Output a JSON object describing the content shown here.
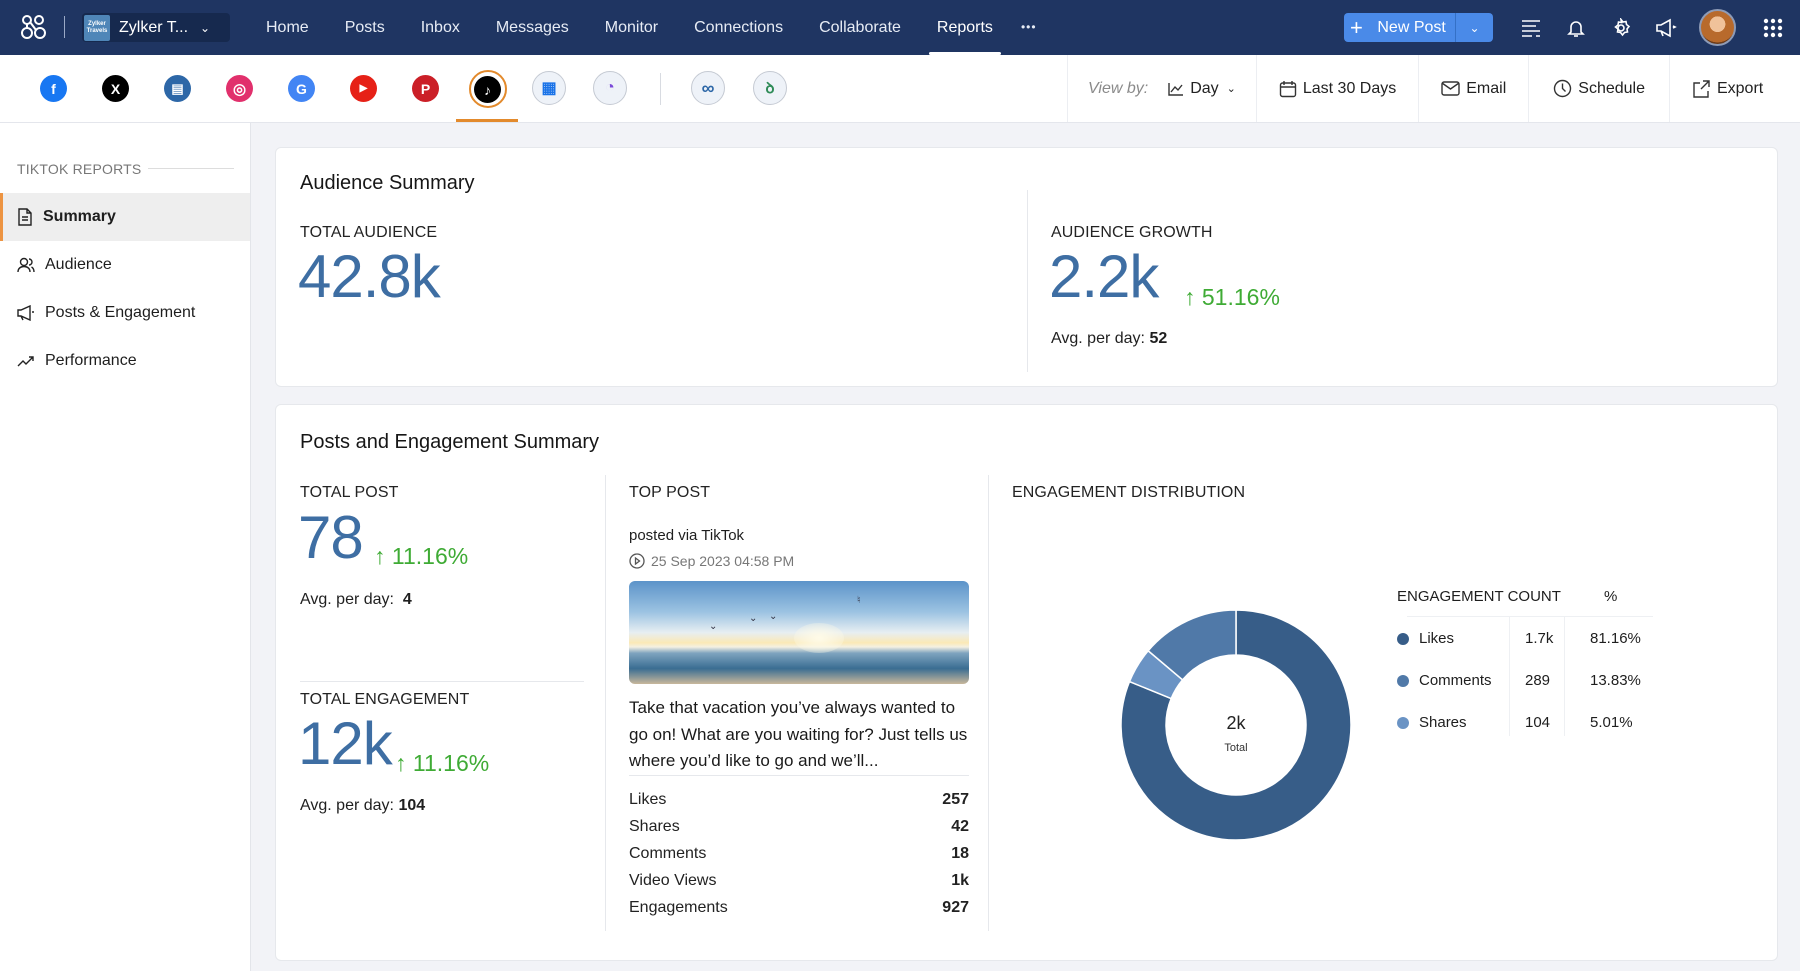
{
  "topbar": {
    "brand_name": "Zylker T...",
    "brand_logo_text": "Zylker Travels",
    "nav": [
      "Home",
      "Posts",
      "Inbox",
      "Messages",
      "Monitor",
      "Connections",
      "Collaborate",
      "Reports"
    ],
    "active_nav": "Reports",
    "more_label": "•••",
    "new_post_label": "New Post",
    "icons": [
      "app-logo-icon",
      "feed-icon",
      "bell-icon",
      "gear-icon",
      "megaphone-icon",
      "avatar",
      "apps-grid-icon"
    ]
  },
  "channels": {
    "items": [
      {
        "name": "facebook",
        "glyph": "f",
        "color": "#1877f2"
      },
      {
        "name": "x",
        "glyph": "𝕏",
        "color": "#000000"
      },
      {
        "name": "linkedin-pages",
        "glyph": "▤",
        "color": "#2d67a7"
      },
      {
        "name": "instagram",
        "glyph": "◎",
        "color": "#e1306c"
      },
      {
        "name": "google-business",
        "glyph": "G",
        "color": "#4285f4"
      },
      {
        "name": "youtube",
        "glyph": "▶",
        "color": "#e62117"
      },
      {
        "name": "pinterest",
        "glyph": "P",
        "color": "#cb1f27"
      },
      {
        "name": "tiktok",
        "glyph": "♪",
        "color": "#000000"
      },
      {
        "name": "google-my-business-grid",
        "glyph": "▦",
        "color": "#1a73e8"
      },
      {
        "name": "zoho-clock",
        "glyph": "◔",
        "color": "#7b4ad8"
      },
      {
        "name": "zoho-link",
        "glyph": "∞",
        "color": "#2d67a7"
      },
      {
        "name": "zoho-other",
        "glyph": "ꝺ",
        "color": "#2e8b57"
      }
    ],
    "active": "tiktok"
  },
  "toolbar": {
    "view_by_label": "View by:",
    "view_by_value": "Day",
    "date_range": "Last 30 Days",
    "email_label": "Email",
    "schedule_label": "Schedule",
    "export_label": "Export"
  },
  "sidebar": {
    "heading": "TIKTOK REPORTS",
    "items": [
      {
        "label": "Summary",
        "icon": "document-icon"
      },
      {
        "label": "Audience",
        "icon": "users-icon"
      },
      {
        "label": "Posts & Engagement",
        "icon": "megaphone-icon"
      },
      {
        "label": "Performance",
        "icon": "trend-up-icon"
      }
    ],
    "active": "Summary"
  },
  "audience_summary": {
    "title": "Audience Summary",
    "total_audience": {
      "label": "TOTAL AUDIENCE",
      "value": "42.8k"
    },
    "audience_growth": {
      "label": "AUDIENCE GROWTH",
      "value": "2.2k",
      "delta": "51.16%",
      "avg_label": "Avg. per day:",
      "avg_value": "52"
    }
  },
  "posts_engagement": {
    "title": "Posts and Engagement Summary",
    "total_post": {
      "label": "TOTAL POST",
      "value": "78",
      "delta": "11.16%",
      "avg_label": "Avg. per day:",
      "avg_value": "4"
    },
    "total_engagement": {
      "label": "TOTAL ENGAGEMENT",
      "value": "12k",
      "delta": "11.16%",
      "avg_label": "Avg. per day:",
      "avg_value": "104"
    },
    "top_post": {
      "label": "TOP POST",
      "posted_via": "posted via TikTok",
      "timestamp": "25 Sep 2023 04:58 PM",
      "caption": "Take that vacation you’ve always wanted to go on! What are you waiting for? Just tells us where you’d like to go and we’ll...",
      "stats": [
        {
          "label": "Likes",
          "value": "257"
        },
        {
          "label": "Shares",
          "value": "42"
        },
        {
          "label": "Comments",
          "value": "18"
        },
        {
          "label": "Video Views",
          "value": "1k"
        },
        {
          "label": "Engagements",
          "value": "927"
        }
      ]
    },
    "distribution": {
      "label": "ENGAGEMENT DISTRIBUTION",
      "center_value": "2k",
      "center_label": "Total",
      "col_count": "ENGAGEMENT COUNT",
      "col_pct": "%"
    }
  },
  "chart_data": {
    "type": "pie",
    "title": "ENGAGEMENT DISTRIBUTION",
    "donut": true,
    "center_text": "2k Total",
    "slices": [
      {
        "label": "Likes",
        "count": "1.7k",
        "value": 81.16,
        "color": "#375d88"
      },
      {
        "label": "Shares",
        "count": "104",
        "value": 5.01,
        "color": "#6a93c4"
      },
      {
        "label": "Comments",
        "count": "289",
        "value": 13.83,
        "color": "#5079a8"
      }
    ],
    "legend_order": [
      "Likes",
      "Comments",
      "Shares"
    ],
    "legend_position": "right"
  }
}
